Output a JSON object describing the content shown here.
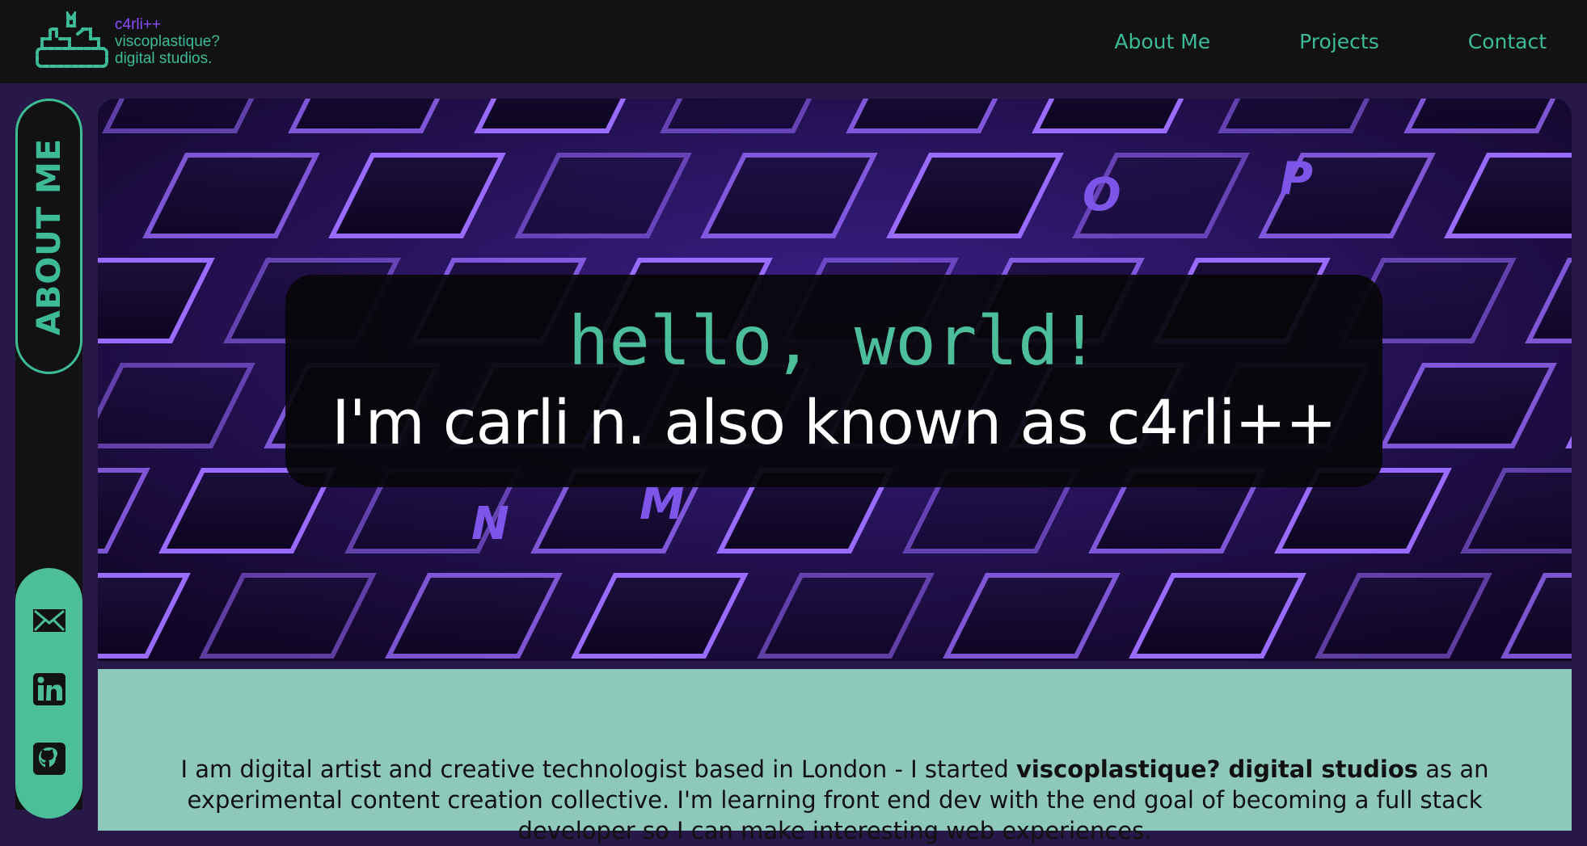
{
  "brand": {
    "line1": "c4rli++",
    "line2": "viscoplastique?",
    "line3": "digital studios."
  },
  "nav": {
    "items": [
      {
        "label": "About Me"
      },
      {
        "label": "Projects"
      },
      {
        "label": "Contact"
      }
    ]
  },
  "sidebar": {
    "about_label": "ABOUT ME",
    "social": [
      {
        "icon": "mail-icon"
      },
      {
        "icon": "linkedin-icon"
      },
      {
        "icon": "github-icon"
      }
    ]
  },
  "hero": {
    "greeting": "hello, world!",
    "intro": "I'm carli n. also known as c4rli++",
    "keycaps": [
      "O",
      "P",
      "N",
      "M"
    ]
  },
  "about": {
    "text_before": "I am digital artist and creative technologist based in London - I started ",
    "studio_name": "viscoplastique? digital studios",
    "text_after": " as an experimental content creation collective. I'm learning front end dev with the end goal of becoming a full stack developer so I can make interesting web experiences."
  },
  "colors": {
    "accent_green": "#3dbb94",
    "accent_purple": "#8a4dff",
    "page_bg": "#271847",
    "bar_bg": "#121214",
    "about_bg": "#8dc8bb"
  }
}
